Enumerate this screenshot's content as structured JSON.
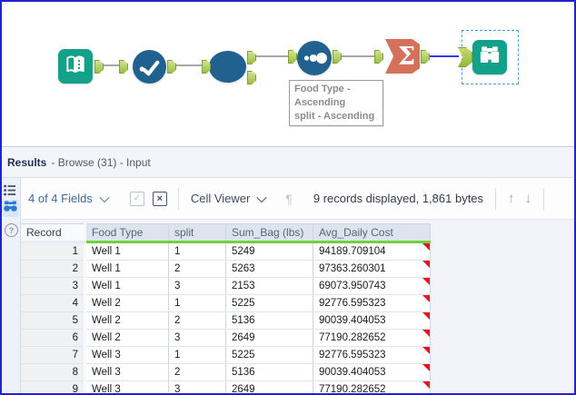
{
  "colors": {
    "tool_teal": "#14A18A",
    "tool_blue": "#20618F",
    "summarize_coral": "#D5705C",
    "anchor_green": "#9CBF41",
    "connection_gray": "#A6A6A6",
    "connection_selected_blue": "#3A3AED",
    "selection_dash_blue": "#4F9BD5",
    "outer_border_blue": "#2121CF",
    "header_underline_green": "#6FD23C",
    "error_flag_red": "#E81123",
    "link_blue": "#3C6A9D"
  },
  "canvas": {
    "summarize_glyph": "Σ",
    "annotation": [
      "Food Type -",
      "Ascending",
      "split - Ascending"
    ]
  },
  "results_header": {
    "title": "Results",
    "subtitle": "- Browse (31) - Input"
  },
  "toolbar": {
    "fields_label": "4 of 4 Fields",
    "apply_icon": "✓",
    "cancel_icon": "×",
    "cell_viewer_label": "Cell Viewer",
    "pilcrow_icon": "¶",
    "records_summary": "9 records displayed, 1,861 bytes",
    "up_icon": "↑",
    "down_icon": "↓"
  },
  "sidebar": {
    "help_icon": "?"
  },
  "table": {
    "columns": [
      "Record",
      "Food Type",
      "split",
      "Sum_Bag (lbs)",
      "Avg_Daily Cost"
    ],
    "rows": [
      [
        "1",
        "Well 1",
        "1",
        "5249",
        "94189.709104"
      ],
      [
        "2",
        "Well 1",
        "2",
        "5263",
        "97363.260301"
      ],
      [
        "3",
        "Well 1",
        "3",
        "2153",
        "69073.950743"
      ],
      [
        "4",
        "Well 2",
        "1",
        "5225",
        "92776.595323"
      ],
      [
        "5",
        "Well 2",
        "2",
        "5136",
        "90039.404053"
      ],
      [
        "6",
        "Well 2",
        "3",
        "2649",
        "77190.282652"
      ],
      [
        "7",
        "Well 3",
        "1",
        "5225",
        "92776.595323"
      ],
      [
        "8",
        "Well 3",
        "2",
        "5136",
        "90039.404053"
      ],
      [
        "9",
        "Well 3",
        "3",
        "2649",
        "77190.282652"
      ]
    ]
  }
}
